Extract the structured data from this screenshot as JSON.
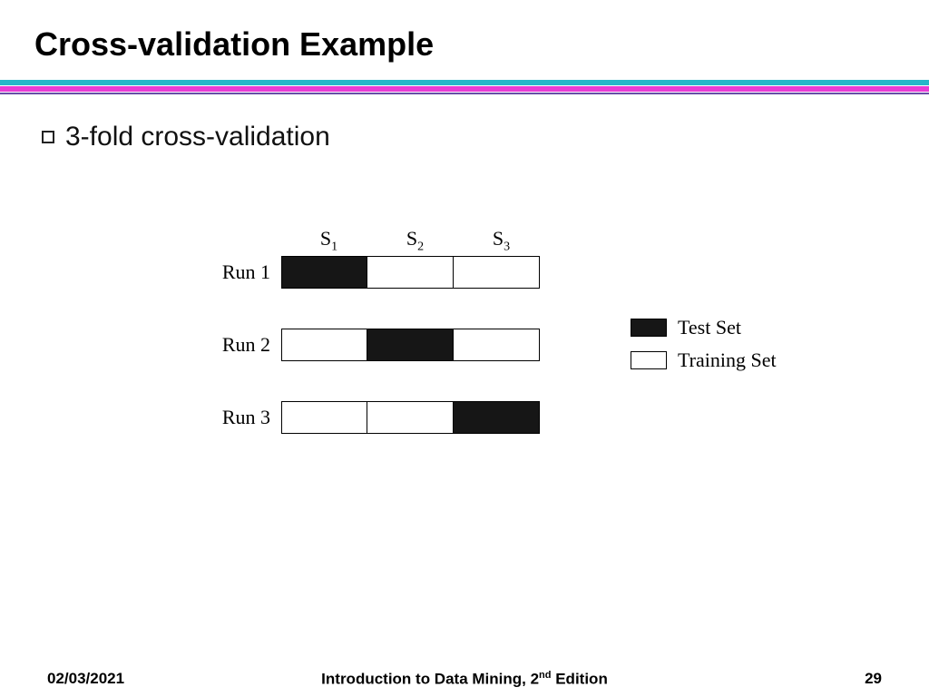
{
  "title": "Cross-validation Example",
  "bullet": "3-fold cross-validation",
  "columns": {
    "s1": "S",
    "s2": "S",
    "s3": "S",
    "sub1": "1",
    "sub2": "2",
    "sub3": "3"
  },
  "runs": {
    "r1": "Run 1",
    "r2": "Run 2",
    "r3": "Run 3"
  },
  "legend": {
    "test": "Test Set",
    "train": "Training Set"
  },
  "footer": {
    "date": "02/03/2021",
    "center_a": "Introduction to Data Mining, 2",
    "center_sup": "nd",
    "center_b": " Edition",
    "page": "29"
  },
  "chart_data": {
    "type": "table",
    "title": "3-fold cross-validation",
    "columns": [
      "S1",
      "S2",
      "S3"
    ],
    "rows": [
      "Run 1",
      "Run 2",
      "Run 3"
    ],
    "cells": [
      [
        "test",
        "train",
        "train"
      ],
      [
        "train",
        "test",
        "train"
      ],
      [
        "train",
        "train",
        "test"
      ]
    ],
    "legend": {
      "test": "Test Set",
      "train": "Training Set"
    }
  }
}
